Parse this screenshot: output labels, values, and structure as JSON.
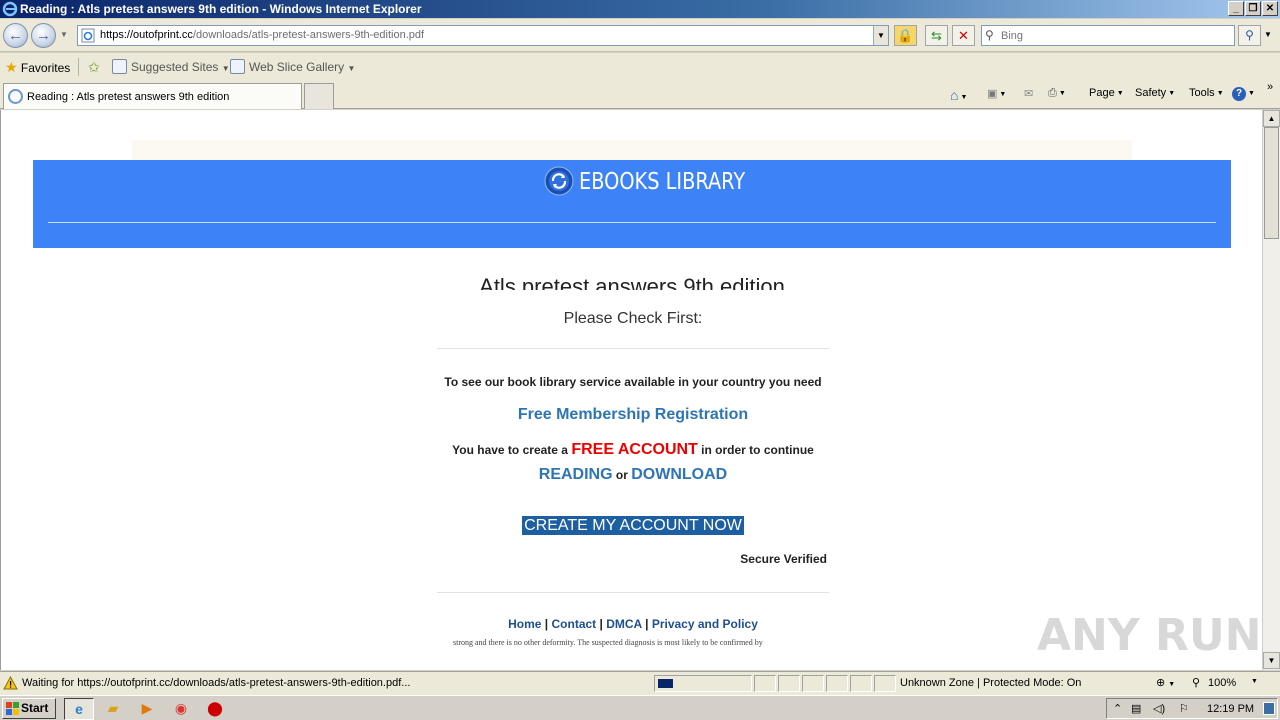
{
  "window": {
    "title": "Reading : Atls pretest answers 9th edition - Windows Internet Explorer"
  },
  "address": {
    "url_host": "https://outofprint.cc",
    "url_path": "/downloads/atls-pretest-answers-9th-edition.pdf"
  },
  "search": {
    "placeholder": "Bing"
  },
  "favorites_bar": {
    "favorites_label": "Favorites",
    "suggested_sites": "Suggested Sites",
    "web_slice_gallery": "Web Slice Gallery"
  },
  "tabs": [
    {
      "label": "Reading : Atls pretest answers 9th edition"
    }
  ],
  "commands": {
    "page": "Page",
    "safety": "Safety",
    "tools": "Tools"
  },
  "page": {
    "brand": "EBOOKS LIBRARY",
    "title": "Atls pretest answers 9th edition",
    "modal": {
      "heading": "Please Check First:",
      "need_text": "To see our book library service available in your country you need",
      "registration_link": "Free Membership Registration",
      "create_prefix": "You have to create a",
      "free_account": "FREE ACCOUNT",
      "create_suffix": "in order to continue",
      "reading": "READING",
      "or": "or",
      "download": "DOWNLOAD",
      "cta": "CREATE MY ACCOUNT NOW",
      "secure": "Secure Verified"
    },
    "footer": {
      "home": "Home",
      "contact": "Contact",
      "dmca": "DMCA",
      "privacy": "Privacy and Policy",
      "sep": "|"
    },
    "background_text": "strong and there is no other deformity. The suspected diagnosis is most likely to be confirmed by",
    "watermark": "ANY RUN"
  },
  "status_bar": {
    "text": "Waiting for https://outofprint.cc/downloads/atls-pretest-answers-9th-edition.pdf...",
    "zone": "Unknown Zone | Protected Mode: On",
    "zoom": "100%"
  },
  "taskbar": {
    "start": "Start",
    "clock": "12:19 PM"
  }
}
